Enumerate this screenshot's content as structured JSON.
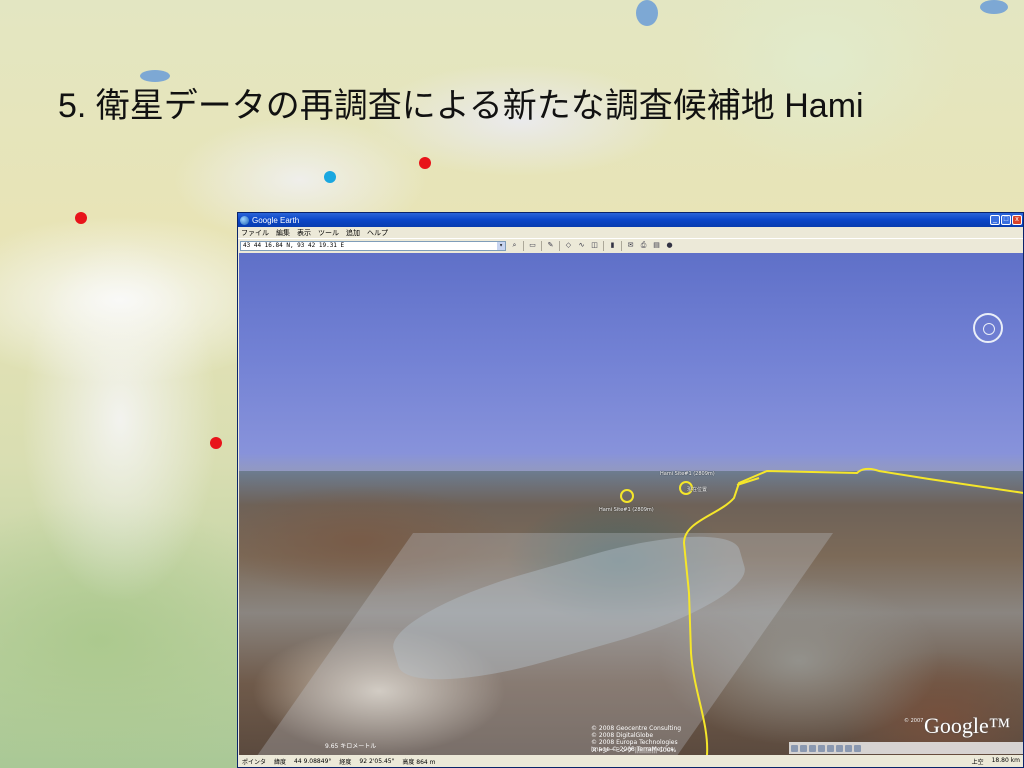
{
  "slide": {
    "title": "5. 衛星データの再調査による新たな調査候補地 Hami"
  },
  "markers": [
    {
      "color": "#e8141a"
    },
    {
      "color": "#e8141a"
    },
    {
      "color": "#e8141a"
    },
    {
      "color": "#1aa7e0"
    }
  ],
  "window": {
    "title": "Google Earth",
    "controls": [
      "_",
      "□",
      "x"
    ]
  },
  "menu": [
    "ファイル",
    "編集",
    "表示",
    "ツール",
    "追加",
    "ヘルプ"
  ],
  "search": {
    "value": "43 44 16.84 N, 93 42 19.31 E"
  },
  "placemarks": [
    {
      "label": "Hami Site#1 (2809m)"
    },
    {
      "label": "Hami Site#1 (2809m)"
    },
    {
      "label": "現在位置"
    }
  ],
  "attribution": [
    "© 2008 Geocentre Consulting",
    "© 2008 DigitalGlobe",
    "© 2008 Europa Technologies",
    "Image © 2008 TerraMetrics"
  ],
  "logo": {
    "text": "Google™",
    "copyright": "© 2007"
  },
  "eye_alt_label": "9.65 キロメートル",
  "streaming": {
    "label": "ストリーミング |||||||||||",
    "percent": "100%"
  },
  "status": {
    "pointer": "ポインタ",
    "lat": "緯度",
    "lat_value": "44 9.08849°",
    "lon": "経度",
    "lon_value": "92 2'05.45\"",
    "elev": "高度 864 m",
    "mode": "上空",
    "eye_alt": "18.80 km"
  },
  "colors": {
    "title_bar": "#0a46c8",
    "border_line": "#f5e62a"
  }
}
